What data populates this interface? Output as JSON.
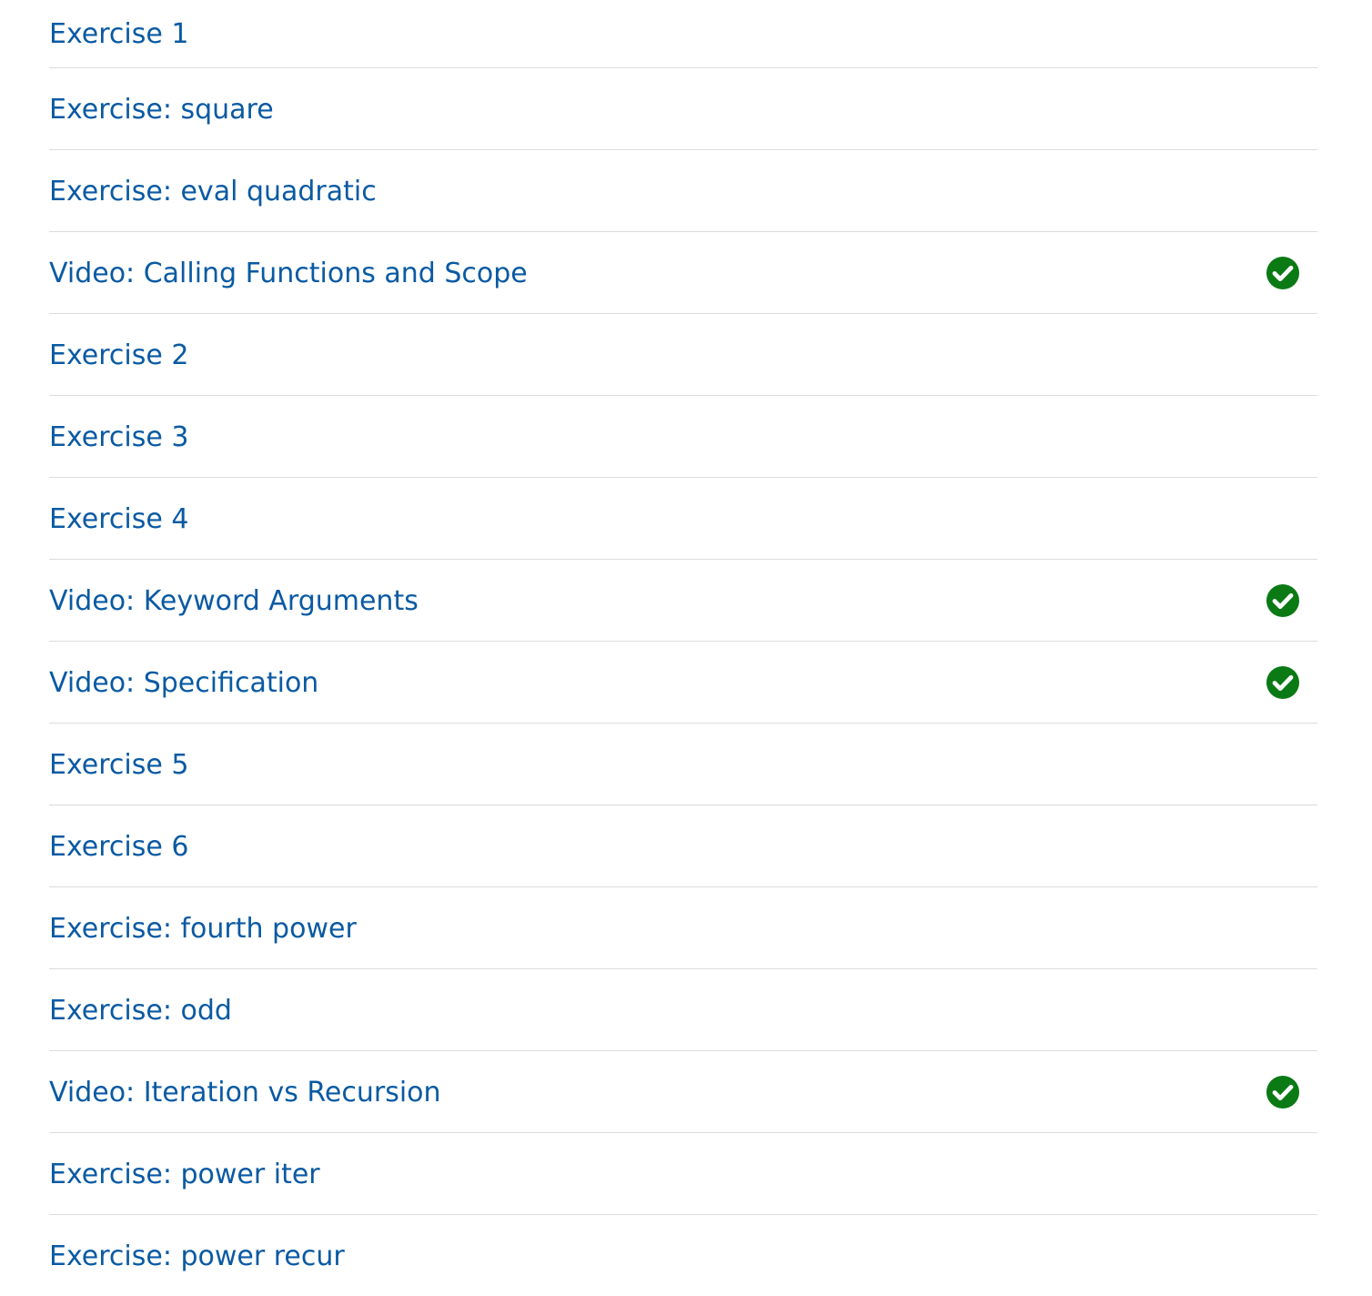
{
  "colors": {
    "link": "#0a5aa3",
    "divider": "#dcdcdc",
    "complete": "#0b7a15"
  },
  "items": [
    {
      "label": "Exercise 1",
      "completed": false
    },
    {
      "label": "Exercise: square",
      "completed": false
    },
    {
      "label": "Exercise: eval quadratic",
      "completed": false
    },
    {
      "label": "Video: Calling Functions and Scope",
      "completed": true,
      "icon": "check-circle-icon"
    },
    {
      "label": "Exercise 2",
      "completed": false
    },
    {
      "label": "Exercise 3",
      "completed": false
    },
    {
      "label": "Exercise 4",
      "completed": false
    },
    {
      "label": "Video: Keyword Arguments",
      "completed": true,
      "icon": "check-circle-icon"
    },
    {
      "label": "Video: Specification",
      "completed": true,
      "icon": "check-circle-icon"
    },
    {
      "label": "Exercise 5",
      "completed": false
    },
    {
      "label": "Exercise 6",
      "completed": false
    },
    {
      "label": "Exercise: fourth power",
      "completed": false
    },
    {
      "label": "Exercise: odd",
      "completed": false
    },
    {
      "label": "Video: Iteration vs Recursion",
      "completed": true,
      "icon": "check-circle-icon"
    },
    {
      "label": "Exercise: power iter",
      "completed": false
    },
    {
      "label": "Exercise: power recur",
      "completed": false
    }
  ]
}
